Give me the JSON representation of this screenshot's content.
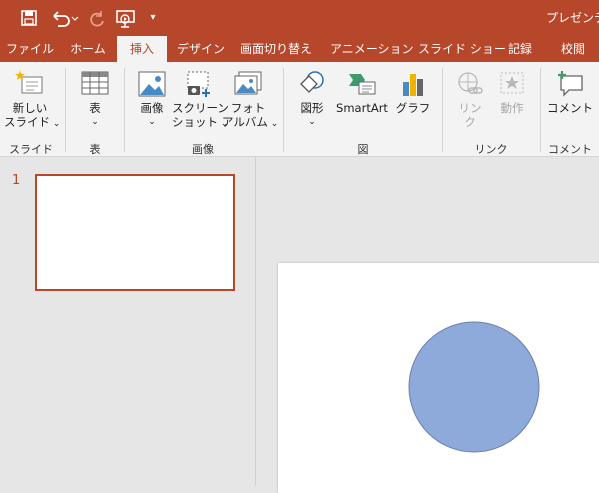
{
  "window": {
    "title": "プレゼンテー"
  },
  "qat": {
    "save": "save-icon",
    "undo": "undo-icon",
    "redo": "redo-icon",
    "present": "present-from-start-icon",
    "customize": "▾"
  },
  "tabs": [
    "ファイル",
    "ホーム",
    "挿入",
    "デザイン",
    "画面切り替え",
    "アニメーション",
    "スライド ショー",
    "記録",
    "校閲"
  ],
  "active_tab": "挿入",
  "ribbon": {
    "new_slide": {
      "line1": "新しい",
      "line2": "スライド"
    },
    "table": {
      "label": "表"
    },
    "images": {
      "label": "画像"
    },
    "screenshot": {
      "line1": "スクリーン",
      "line2": "ショット"
    },
    "photo_album": {
      "line1": "フォト",
      "line2": "アルバム"
    },
    "shapes": {
      "label": "図形"
    },
    "smartart": {
      "label": "SmartArt"
    },
    "chart": {
      "label": "グラフ"
    },
    "link": {
      "line1": "リン",
      "line2": "ク"
    },
    "action": {
      "label": "動作"
    },
    "comment": {
      "label": "コメント"
    },
    "groups": {
      "slides": "スライド",
      "tables": "表",
      "images": "画像",
      "illustrations": "図",
      "links": "リンク",
      "comments": "コメント"
    }
  },
  "slides_pane": {
    "slide_number": "1"
  },
  "colors": {
    "accent": "#b7472a",
    "ribbon_bg": "#f3f3f3",
    "workspace_bg": "#e6e6e6",
    "circle_fill": "#8eaadb",
    "circle_stroke": "#6b7fa8"
  }
}
